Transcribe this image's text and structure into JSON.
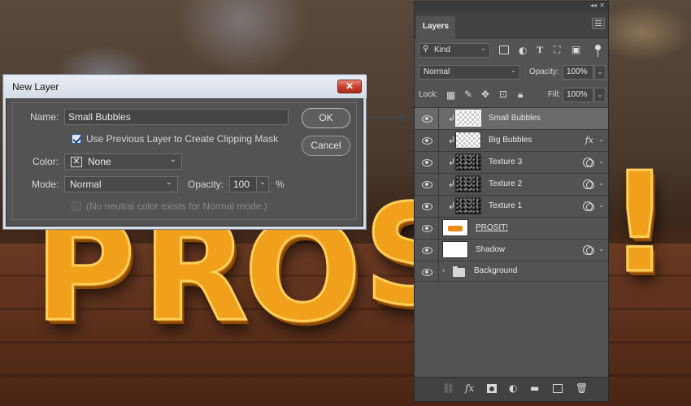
{
  "scene": {
    "letters": [
      "P",
      "R",
      "O",
      "S",
      "!"
    ]
  },
  "dialog": {
    "title": "New Layer",
    "close_glyph": "✕",
    "name_label": "Name:",
    "name_value": "Small Bubbles",
    "clip_checkbox_label": "Use Previous Layer to Create Clipping Mask",
    "clip_checked": true,
    "color_label": "Color:",
    "color_value": "None",
    "mode_label": "Mode:",
    "mode_value": "Normal",
    "opacity_label": "Opacity:",
    "opacity_value": "100",
    "opacity_unit": "%",
    "neutral_note": "(No neutral color exists for Normal mode.)",
    "ok_label": "OK",
    "cancel_label": "Cancel"
  },
  "panel": {
    "tab_label": "Layers",
    "collapse_glyph": "◂◂",
    "close_glyph": "✕",
    "filter_label": "Kind",
    "blend_mode": "Normal",
    "opacity_label": "Opacity:",
    "opacity_value": "100%",
    "lock_label": "Lock:",
    "fill_label": "Fill:",
    "fill_value": "100%",
    "layers": [
      {
        "name": "Small Bubbles",
        "clipped": true,
        "thumb": "transparent",
        "selected": true,
        "fx": ""
      },
      {
        "name": "Big Bubbles",
        "clipped": true,
        "thumb": "transparent",
        "selected": false,
        "fx": "fx"
      },
      {
        "name": "Texture 3",
        "clipped": true,
        "thumb": "dark",
        "selected": false,
        "fx": "circles"
      },
      {
        "name": "Texture 2",
        "clipped": true,
        "thumb": "dark",
        "selected": false,
        "fx": "circles"
      },
      {
        "name": "Texture 1",
        "clipped": true,
        "thumb": "dark",
        "selected": false,
        "fx": "circles"
      },
      {
        "name": "PROSIT!",
        "clipped": false,
        "thumb": "orange",
        "selected": false,
        "fx": ""
      },
      {
        "name": "Shadow",
        "clipped": false,
        "thumb": "transparent",
        "selected": false,
        "fx": "circles"
      },
      {
        "name": "Background",
        "clipped": false,
        "thumb": "folder",
        "selected": false,
        "fx": ""
      }
    ],
    "colors": {
      "panel_bg": "#535353",
      "selected_row": "#6a6a6a",
      "accent_orange": "#f0a01a"
    }
  }
}
